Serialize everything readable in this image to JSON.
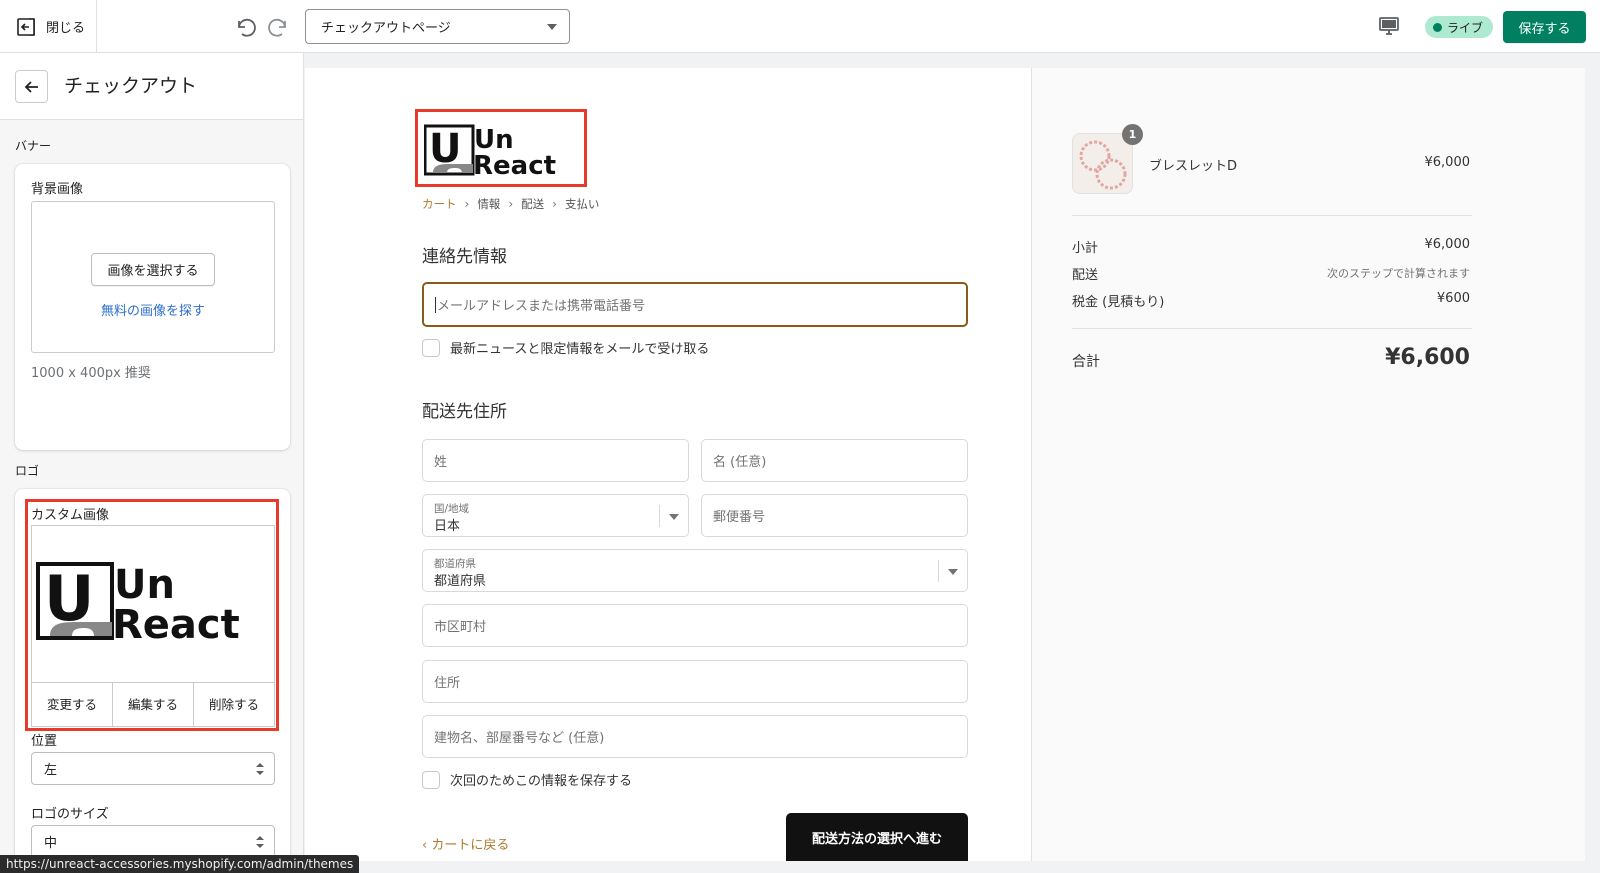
{
  "topbar": {
    "close_label": "閉じる",
    "page_select_value": "チェックアウトページ",
    "live_label": "ライブ",
    "save_label": "保存する"
  },
  "sidebar": {
    "title": "チェックアウト",
    "banner_section": "バナー",
    "background_image_label": "背景画像",
    "select_image_button": "画像を選択する",
    "free_image_link": "無料の画像を探す",
    "recommended_size": "1000 x 400px 推奨",
    "logo_section": "ロゴ",
    "custom_image_label": "カスタム画像",
    "logo_actions": [
      "変更する",
      "編集する",
      "削除する"
    ],
    "position_label": "位置",
    "position_value": "左",
    "logo_size_label": "ロゴのサイズ",
    "logo_size_value": "中"
  },
  "logo": {
    "line1": "Un",
    "line2": "React",
    "mark": "U"
  },
  "checkout": {
    "breadcrumb": [
      "カート",
      "情報",
      "配送",
      "支払い"
    ],
    "contact_heading": "連絡先情報",
    "email_placeholder": "メールアドレスまたは携帯電話番号",
    "newsletter_label": "最新ニュースと限定情報をメールで受け取る",
    "shipping_heading": "配送先住所",
    "last_name_placeholder": "姓",
    "first_name_placeholder": "名 (任意)",
    "country_label": "国/地域",
    "country_value": "日本",
    "postal_placeholder": "郵便番号",
    "prefecture_label": "都道府県",
    "prefecture_value": "都道府県",
    "city_placeholder": "市区町村",
    "address_placeholder": "住所",
    "building_placeholder": "建物名、部屋番号など (任意)",
    "save_info_label": "次回のためこの情報を保存する",
    "return_link": "カートに戻る",
    "continue_button": "配送方法の選択へ進む"
  },
  "summary": {
    "quantity": "1",
    "product_name": "ブレスレットD",
    "product_price": "¥6,000",
    "subtotal_label": "小計",
    "subtotal_value": "¥6,000",
    "shipping_label": "配送",
    "shipping_value": "次のステップで計算されます",
    "tax_label": "税金 (見積もり)",
    "tax_value": "¥600",
    "total_label": "合計",
    "total_value": "¥6,600"
  },
  "status_url": "https://unreact-accessories.myshopify.com/admin/themes",
  "colors": {
    "accent_green": "#008060",
    "highlight_red": "#e63b2a",
    "checkout_accent": "#b07a2b"
  }
}
